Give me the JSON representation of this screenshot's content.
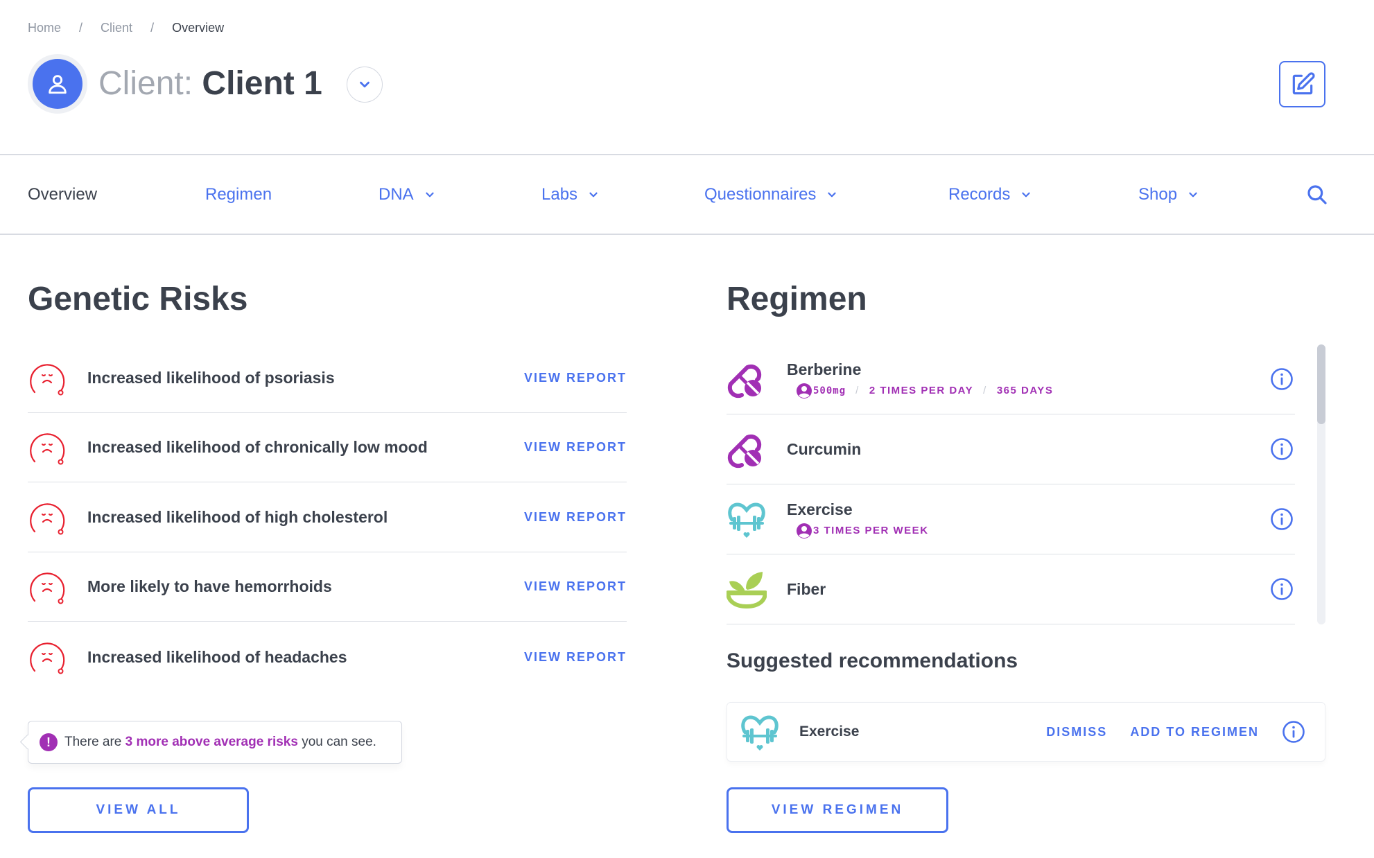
{
  "breadcrumb": [
    "Home",
    "Client",
    "Overview"
  ],
  "header": {
    "title_prefix": "Client:",
    "client_name": "Client 1"
  },
  "nav": {
    "items": [
      {
        "label": "Overview",
        "active": true,
        "dropdown": false
      },
      {
        "label": "Regimen",
        "active": false,
        "dropdown": false
      },
      {
        "label": "DNA",
        "active": false,
        "dropdown": true
      },
      {
        "label": "Labs",
        "active": false,
        "dropdown": true
      },
      {
        "label": "Questionnaires",
        "active": false,
        "dropdown": true
      },
      {
        "label": "Records",
        "active": false,
        "dropdown": true
      },
      {
        "label": "Shop",
        "active": false,
        "dropdown": true
      }
    ],
    "search_icon": "search-icon"
  },
  "genetic_risks": {
    "title": "Genetic Risks",
    "items": [
      {
        "label": "Increased likelihood of psoriasis",
        "action": "VIEW REPORT"
      },
      {
        "label": "Increased likelihood of chronically low mood",
        "action": "VIEW REPORT"
      },
      {
        "label": "Increased likelihood of high cholesterol",
        "action": "VIEW REPORT"
      },
      {
        "label": "More likely to have hemorrhoids",
        "action": "VIEW REPORT"
      },
      {
        "label": "Increased likelihood of headaches",
        "action": "VIEW REPORT"
      }
    ],
    "tooltip": {
      "prefix": "There are ",
      "highlight": "3 more above average risks",
      "suffix": " you can see."
    },
    "view_all_label": "VIEW ALL"
  },
  "regimen": {
    "title": "Regimen",
    "items": [
      {
        "name": "Berberine",
        "icon": "pill-icon",
        "meta": [
          "500mg",
          "2 TIMES PER DAY",
          "365 DAYS"
        ]
      },
      {
        "name": "Curcumin",
        "icon": "pill-icon",
        "meta": []
      },
      {
        "name": "Exercise",
        "icon": "heart-dumbbell-icon",
        "meta": [
          "3 TIMES PER WEEK"
        ]
      },
      {
        "name": "Fiber",
        "icon": "leaf-bowl-icon",
        "meta": []
      }
    ],
    "suggested": {
      "title": "Suggested recommendations",
      "items": [
        {
          "name": "Exercise",
          "icon": "heart-dumbbell-icon",
          "dismiss": "DISMISS",
          "add": "ADD TO REGIMEN"
        }
      ]
    },
    "view_regimen_label": "VIEW REGIMEN"
  },
  "colors": {
    "accent": "#4a72ee",
    "text": "#3b414c",
    "muted": "#9097a3",
    "risk": "#e8202f",
    "purple": "#a12fb4",
    "teal": "#5ec5d0",
    "green": "#a9cf55"
  }
}
